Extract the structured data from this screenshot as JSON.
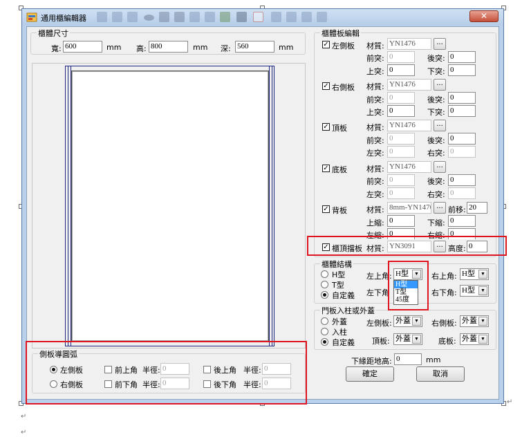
{
  "window": {
    "title": "通用櫃編輯器",
    "close_label": "✕"
  },
  "size_group": {
    "title": "櫃體尺寸",
    "width": {
      "label": "寬:",
      "value": "600",
      "unit": "mm"
    },
    "height": {
      "label": "高:",
      "value": "800",
      "unit": "mm"
    },
    "depth": {
      "label": "深:",
      "value": "560",
      "unit": "mm"
    }
  },
  "board_edit": {
    "title": "櫃體板編輯",
    "material_label": "材質:",
    "more_label": "...",
    "left": {
      "label": "左側板",
      "material": "YN1476",
      "front_label": "前突:",
      "front": "0",
      "back_label": "後突:",
      "back": "0",
      "top_label": "上突:",
      "top": "0",
      "bottom_label": "下突:",
      "bottom": "0"
    },
    "right": {
      "label": "右側板",
      "material": "YN1476",
      "front_label": "前突:",
      "front": "0",
      "back_label": "後突:",
      "back": "0",
      "top_label": "上突:",
      "top": "0",
      "bottom_label": "下突:",
      "bottom": "0"
    },
    "top": {
      "label": "頂板",
      "material": "YN1476",
      "front_label": "前突:",
      "front": "0",
      "back_label": "後突:",
      "back": "0",
      "l_label": "左突:",
      "l": "0",
      "r_label": "右突:",
      "r": "0"
    },
    "bottom": {
      "label": "底板",
      "material": "YN1476",
      "front_label": "前突:",
      "front": "0",
      "back_label": "後突:",
      "back": "0",
      "l_label": "左突:",
      "l": "0",
      "r_label": "右突:",
      "r": "0"
    },
    "back": {
      "label": "背板",
      "material": "8mm-YN1476",
      "offset_label": "前移:",
      "offset": "20",
      "t_label": "上縮:",
      "t": "0",
      "b_label": "下縮:",
      "b": "0",
      "l_label": "左縮:",
      "l": "0",
      "r_label": "右縮:",
      "r": "0"
    },
    "cap": {
      "label": "櫃頂擋板",
      "material": "YN3091",
      "height_label": "高度:",
      "height": "0"
    }
  },
  "structure": {
    "title": "櫃體結構",
    "opt_h": "H型",
    "opt_t": "T型",
    "opt_custom": "自定義",
    "tl_label": "左上角:",
    "tl_value": "H型",
    "tr_label": "右上角:",
    "tr_value": "H型",
    "bl_label": "左下角",
    "br_label": "右下角:",
    "br_value": "H型",
    "dropdown_options": [
      "H型",
      "T型",
      "45度"
    ]
  },
  "door": {
    "title": "門板入柱或外蓋",
    "opt_cover": "外蓋",
    "opt_inset": "入柱",
    "opt_custom": "自定義",
    "left_label": "左側板:",
    "left_value": "外蓋",
    "right_label": "右側板:",
    "right_value": "外蓋",
    "top_label": "頂板:",
    "top_value": "外蓋",
    "bottom_label": "底板:",
    "bottom_value": "外蓋"
  },
  "floor_gap": {
    "label": "下緣距地高:",
    "value": "0",
    "unit": "mm"
  },
  "buttons": {
    "ok": "確定",
    "cancel": "取消"
  },
  "arc": {
    "title": "側板導圓弧",
    "left_side": "左側板",
    "right_side": "右側板",
    "front_top": "前上角",
    "front_bottom": "前下角",
    "back_top": "後上角",
    "back_bottom": "後下角",
    "radius_label": "半徑:",
    "radius_values": [
      "0",
      "0",
      "0",
      "0"
    ]
  },
  "marks": {
    "para": "↵"
  }
}
